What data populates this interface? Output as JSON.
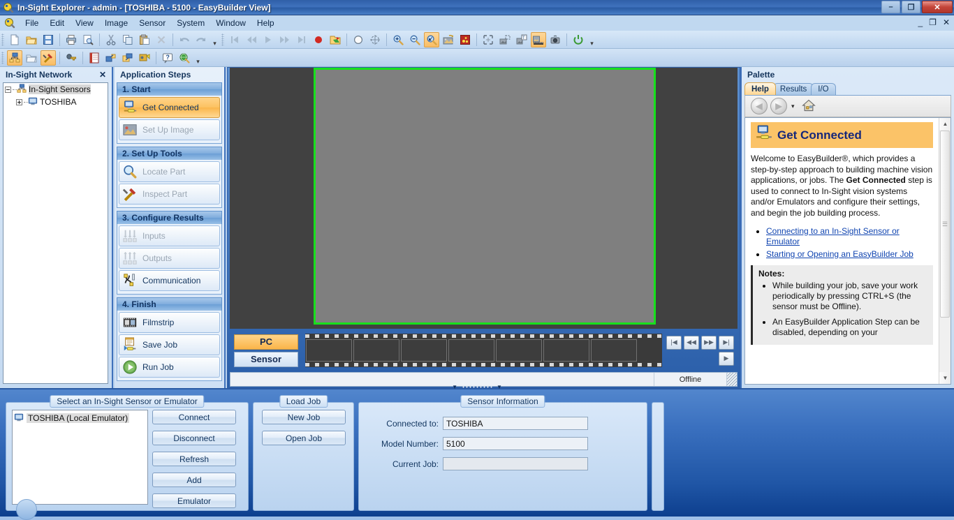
{
  "window": {
    "title": "In-Sight Explorer - admin - [TOSHIBA - 5100 - EasyBuilder View]",
    "app_icon": "insight-logo-icon",
    "minimize": "–",
    "maximize": "❐",
    "close": "✕",
    "mdi_minimize": "_",
    "mdi_restore": "❐",
    "mdi_close": "✕"
  },
  "menu": {
    "items": [
      {
        "label": "File",
        "accel": "F"
      },
      {
        "label": "Edit",
        "accel": "E"
      },
      {
        "label": "View",
        "accel": "V"
      },
      {
        "label": "Image",
        "accel": "I"
      },
      {
        "label": "Sensor",
        "accel": "S"
      },
      {
        "label": "System",
        "accel": "y"
      },
      {
        "label": "Window",
        "accel": "W"
      },
      {
        "label": "Help",
        "accel": "H"
      }
    ]
  },
  "toolbar1": {
    "items": [
      {
        "name": "new-icon",
        "glyph": "page"
      },
      {
        "name": "open-icon",
        "glyph": "folder-open"
      },
      {
        "name": "save-icon",
        "glyph": "floppy"
      },
      {
        "name": "separator",
        "glyph": "sep"
      },
      {
        "name": "print-icon",
        "glyph": "printer"
      },
      {
        "name": "print-preview-icon",
        "glyph": "preview"
      },
      {
        "name": "separator",
        "glyph": "sep"
      },
      {
        "name": "cut-icon",
        "glyph": "scissors"
      },
      {
        "name": "copy-icon",
        "glyph": "copy"
      },
      {
        "name": "paste-icon",
        "glyph": "paste"
      },
      {
        "name": "delete-icon",
        "glyph": "x-gray"
      },
      {
        "name": "separator",
        "glyph": "sep"
      },
      {
        "name": "undo-icon",
        "glyph": "undo"
      },
      {
        "name": "redo-icon",
        "glyph": "redo"
      },
      {
        "name": "overflow-icon",
        "glyph": "more"
      },
      {
        "name": "gap",
        "glyph": "gap"
      },
      {
        "name": "first-record-icon",
        "glyph": "first"
      },
      {
        "name": "prev-record-icon",
        "glyph": "prev"
      },
      {
        "name": "play-record-icon",
        "glyph": "play"
      },
      {
        "name": "next-record-icon",
        "glyph": "next"
      },
      {
        "name": "last-record-icon",
        "glyph": "last"
      },
      {
        "name": "record-icon",
        "glyph": "record"
      },
      {
        "name": "load-image-icon",
        "glyph": "img-folder"
      },
      {
        "name": "separator",
        "glyph": "sep"
      },
      {
        "name": "circle-tool-icon",
        "glyph": "circle"
      },
      {
        "name": "crosshair-tool-icon",
        "glyph": "crosshair"
      },
      {
        "name": "separator",
        "glyph": "sep"
      },
      {
        "name": "zoom-in-icon",
        "glyph": "zoomin"
      },
      {
        "name": "zoom-out-icon",
        "glyph": "zoomout"
      },
      {
        "name": "zoom-fit-icon",
        "glyph": "zoomfit",
        "active": true
      },
      {
        "name": "image-display-icon",
        "glyph": "imgdisp"
      },
      {
        "name": "palette-icon",
        "glyph": "palette"
      },
      {
        "name": "separator",
        "glyph": "sep"
      },
      {
        "name": "fullscreen-icon",
        "glyph": "fullscr"
      },
      {
        "name": "graphics-icon",
        "glyph": "graphics"
      },
      {
        "name": "result-graphics-icon",
        "glyph": "resgraph"
      },
      {
        "name": "filmstrip-icon",
        "glyph": "film",
        "active": true
      },
      {
        "name": "live-video-icon",
        "glyph": "livevid"
      },
      {
        "name": "separator",
        "glyph": "sep"
      },
      {
        "name": "online-offline-icon",
        "glyph": "power"
      },
      {
        "name": "overflow-icon",
        "glyph": "more"
      }
    ]
  },
  "toolbar2": {
    "items": [
      {
        "name": "in-sight-network-icon",
        "glyph": "network",
        "active": true
      },
      {
        "name": "in-sight-files-icon",
        "glyph": "folder2"
      },
      {
        "name": "easybuilder-view-icon",
        "glyph": "tools",
        "active": true
      },
      {
        "name": "separator",
        "glyph": "sep"
      },
      {
        "name": "user-access-icon",
        "glyph": "key"
      },
      {
        "name": "separator",
        "glyph": "sep"
      },
      {
        "name": "spreadsheet-icon",
        "glyph": "sheet"
      },
      {
        "name": "add-device-icon",
        "glyph": "adddev"
      },
      {
        "name": "backup-icon",
        "glyph": "backup"
      },
      {
        "name": "restore-icon",
        "glyph": "restore"
      },
      {
        "name": "separator",
        "glyph": "sep"
      },
      {
        "name": "help-icon",
        "glyph": "help"
      },
      {
        "name": "web-help-icon",
        "glyph": "webhelp"
      },
      {
        "name": "overflow-icon",
        "glyph": "more"
      }
    ]
  },
  "network_panel": {
    "caption": "In-Sight Network",
    "close_label": "✕",
    "tree": [
      {
        "label": "In-Sight Sensors",
        "level": 1,
        "expanded": true,
        "icon": "network-icon",
        "selected": true
      },
      {
        "label": "TOSHIBA",
        "level": 2,
        "expanded": false,
        "icon": "sensor-icon",
        "selected": false
      }
    ]
  },
  "app_steps": {
    "caption": "Application Steps",
    "groups": [
      {
        "title": "1. Start",
        "steps": [
          {
            "label": "Get Connected",
            "icon": "get-connected-icon",
            "state": "active"
          },
          {
            "label": "Set Up Image",
            "icon": "set-up-image-icon",
            "state": "disabled"
          }
        ]
      },
      {
        "title": "2. Set Up Tools",
        "steps": [
          {
            "label": "Locate Part",
            "icon": "locate-part-icon",
            "state": "disabled"
          },
          {
            "label": "Inspect Part",
            "icon": "inspect-part-icon",
            "state": "disabled"
          }
        ]
      },
      {
        "title": "3. Configure Results",
        "steps": [
          {
            "label": "Inputs",
            "icon": "inputs-icon",
            "state": "disabled"
          },
          {
            "label": "Outputs",
            "icon": "outputs-icon",
            "state": "disabled"
          },
          {
            "label": "Communication",
            "icon": "communication-icon",
            "state": "normal"
          }
        ]
      },
      {
        "title": "4. Finish",
        "steps": [
          {
            "label": "Filmstrip",
            "icon": "filmstrip-icon",
            "state": "normal"
          },
          {
            "label": "Save Job",
            "icon": "save-job-icon",
            "state": "normal"
          },
          {
            "label": "Run Job",
            "icon": "run-job-icon",
            "state": "normal"
          }
        ]
      }
    ]
  },
  "image_view": {
    "source_toggle": {
      "pc": "PC",
      "sensor": "Sensor",
      "selected": "PC"
    },
    "filmstrip_frames": 7,
    "nav": {
      "first": "|◀",
      "prev": "◀◀",
      "next": "▶▶",
      "last": "▶|",
      "play": "▶"
    },
    "status": "Offline",
    "selection_border_color": "#17e01c",
    "image_background": "#7f7f7f",
    "canvas_background": "#414141"
  },
  "palette": {
    "caption": "Palette",
    "tabs": [
      {
        "label": "Help",
        "selected": true
      },
      {
        "label": "Results",
        "selected": false
      },
      {
        "label": "I/O",
        "selected": false
      }
    ],
    "nav": {
      "back": "◀",
      "forward": "▶",
      "dropdown": "▾",
      "home": "home-icon"
    },
    "help": {
      "title": "Get Connected",
      "title_icon": "get-connected-icon",
      "paragraph_1": "Welcome to EasyBuilder®, which provides a step-by-step approach to building machine vision applications, or jobs. The ",
      "paragraph_bold_1": "Get Connected",
      "paragraph_2": " step is used to connect to In-Sight vision systems and/or Emulators and configure their settings, and begin the job building process.",
      "links": [
        "Connecting to an In-Sight Sensor or Emulator",
        "Starting or Opening an EasyBuilder Job"
      ],
      "notes_title": "Notes:",
      "notes": [
        "While building your job, save your work periodically by pressing CTRL+S (the sensor must be Offline).",
        "An EasyBuilder Application Step can be disabled, depending on your"
      ]
    },
    "scrollbar": {
      "up": "▲",
      "down": "▼"
    }
  },
  "bottom_panel": {
    "select_group": {
      "title": "Select an In-Sight Sensor or Emulator",
      "list": [
        {
          "label": "TOSHIBA (Local Emulator)",
          "icon": "sensor-icon",
          "selected": true
        }
      ],
      "buttons": [
        "Connect",
        "Disconnect",
        "Refresh",
        "Add",
        "Emulator"
      ]
    },
    "load_job_group": {
      "title": "Load Job",
      "buttons": [
        "New Job",
        "Open Job"
      ]
    },
    "sensor_info_group": {
      "title": "Sensor Information",
      "fields": [
        {
          "label": "Connected to:",
          "value": "TOSHIBA"
        },
        {
          "label": "Model Number:",
          "value": "5100"
        },
        {
          "label": "Current Job:",
          "value": ""
        }
      ]
    }
  },
  "colors": {
    "title_blue": "#3f72bd",
    "accent_orange": "#fbc368",
    "panel_blue": "#b7d0ec",
    "link_blue": "#1044b0",
    "selection_green": "#17e01c"
  }
}
